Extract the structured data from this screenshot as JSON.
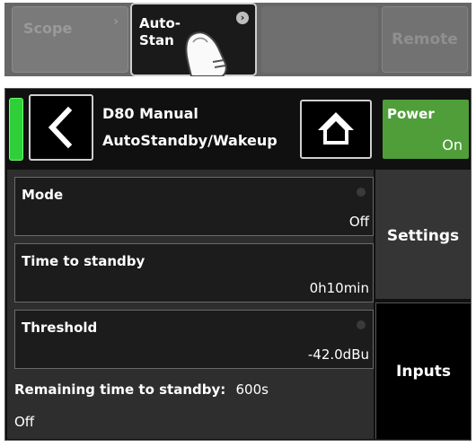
{
  "top_strip": {
    "scope_label": "Scope",
    "scope_chevron": "›",
    "auto_line1": "Auto-",
    "auto_line2": "Stan",
    "auto_chevron": "›",
    "remote_label": "Remote",
    "finger_icon": "pointing-finger-icon"
  },
  "header": {
    "back_icon": "chevron-left-icon",
    "device_name": "D80 Manual",
    "page_title": "AutoStandby/Wakeup",
    "home_icon": "home-icon",
    "power_label": "Power",
    "power_value": "On",
    "led_color": "#2fcf3a"
  },
  "params": [
    {
      "label": "Mode",
      "value": "Off"
    },
    {
      "label": "Time to standby",
      "value": "0h10min"
    },
    {
      "label": "Threshold",
      "value": "-42.0dBu"
    }
  ],
  "remaining": {
    "label": "Remaining time to standby:",
    "value": "600s"
  },
  "status": "Off",
  "tabs": {
    "settings": "Settings",
    "inputs": "Inputs"
  },
  "colors": {
    "power_green": "#4f9e3a",
    "led_green": "#2fcf3a"
  }
}
